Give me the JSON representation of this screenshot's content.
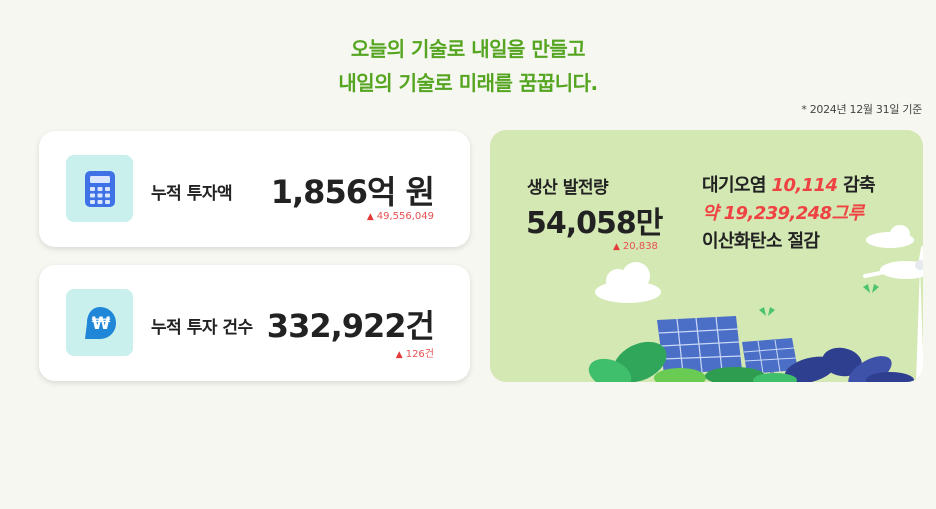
{
  "headline": {
    "line1": "오늘의 기술로 내일을 만들고",
    "line2": "내일의 기술로 미래를 꿈꿉니다."
  },
  "basis_date": "* 2024년 12월 31일 기준",
  "cards": [
    {
      "icon": "calculator-icon",
      "label": "누적 투자액",
      "value": "1,856억 원",
      "delta": "49,556,049",
      "delta_direction": "up"
    },
    {
      "icon": "won-pin-icon",
      "label": "누적 투자 건수",
      "value": "332,922건",
      "delta": "126건",
      "delta_direction": "up"
    }
  ],
  "eco": {
    "production_label": "생산 발전량",
    "production_value": "54,058만",
    "production_delta": "20,838",
    "air_prefix": "대기오염",
    "air_value": "10,114",
    "air_suffix": "감축",
    "trees": "약 19,239,248그루",
    "co2_text": "이산화탄소 절감"
  },
  "colors": {
    "headline": "#55a521",
    "accent_red": "#ef4343",
    "eco_panel": "#d4e8b4",
    "icon_bg": "#c9f0ec"
  }
}
